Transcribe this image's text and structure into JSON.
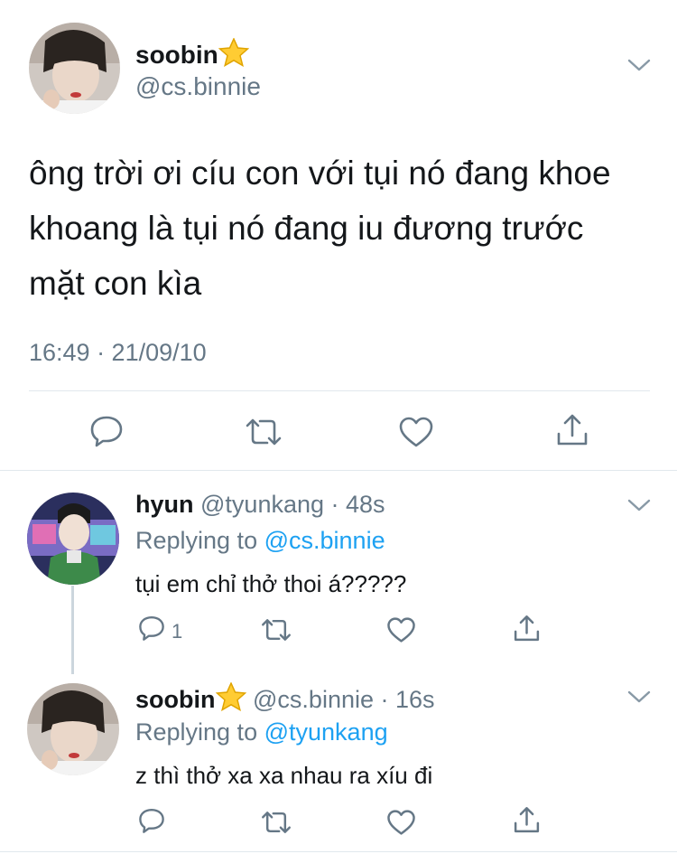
{
  "main_tweet": {
    "name": "soobin",
    "handle": "@cs.binnie",
    "text_lines": [
      "ông trời ơi cíu con với tụi nó đang khoe",
      "khoang là tụi nó đang iu đương trước",
      "mặt con kìa"
    ],
    "timestamp": "16:49 · 21/09/10",
    "avatar_icon": "avatar-photo",
    "star_icon": "star-emoji"
  },
  "replies": [
    {
      "name": "hyun",
      "handle": "@tyunkang",
      "time": "· 48s",
      "replying_prefix": "Replying to",
      "replying_to": "@cs.binnie",
      "text": "tụi em chỉ thở thoi á?????",
      "reply_count": "1"
    },
    {
      "name": "soobin",
      "handle": "@cs.binnie",
      "time": "· 16s",
      "replying_prefix": "Replying to",
      "replying_to": "@tyunkang",
      "text": "z thì thở xa xa nhau ra xíu đi",
      "reply_count": ""
    }
  ],
  "colors": {
    "text": "#14171a",
    "secondary": "#657786",
    "link": "#1da1f2",
    "divider": "#e1e8ed",
    "icon": "#657786"
  }
}
